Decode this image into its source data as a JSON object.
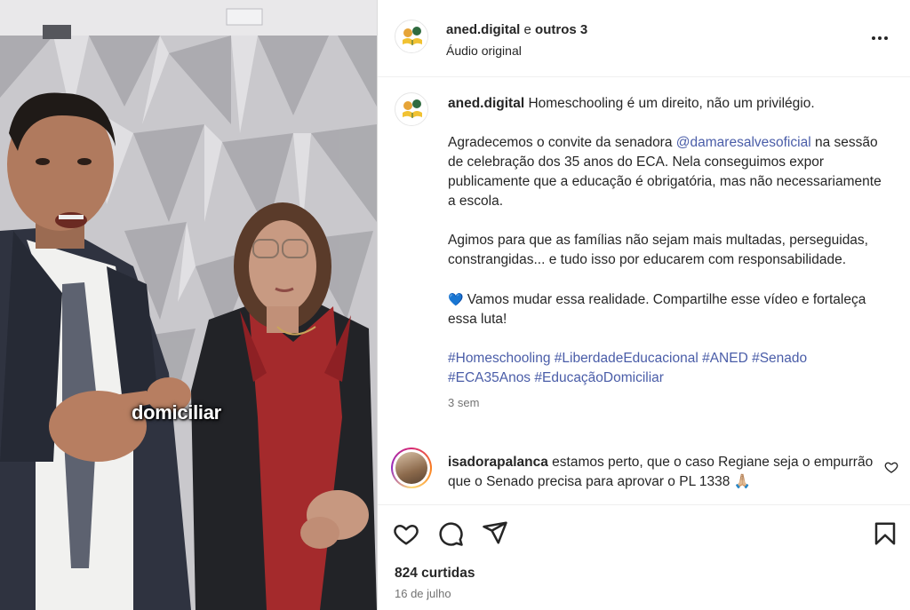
{
  "media": {
    "caption_word": "domiciliar"
  },
  "header": {
    "author": "aned.digital",
    "connector": "e",
    "others": "outros 3",
    "subtitle": "Áudio original"
  },
  "post": {
    "username": "aned.digital",
    "line1": "Homeschooling é um direito, não um privilégio.",
    "p2_before": "Agradecemos o convite da senadora ",
    "p2_mention": "@damaresalvesoficial",
    "p2_after": " na sessão de celebração dos 35 anos do ECA. Nela conseguimos expor publicamente que a educação é obrigatória, mas não necessariamente a escola.",
    "p3": "Agimos para que as famílias não sejam mais multadas, perseguidas, constrangidas... e tudo isso por educarem com responsabilidade.",
    "p4_emoji": "💙",
    "p4": " Vamos mudar essa realidade. Compartilhe esse vídeo e fortaleça essa luta!",
    "hashtags": "#Homeschooling #LiberdadeEducacional #ANED #Senado #ECA35Anos #EducaçãoDomiciliar",
    "time": "3 sem"
  },
  "comment": {
    "username": "isadorapalanca",
    "text": " estamos perto, que o caso Regiane seja o empurrão que o Senado precisa para aprovar o PL 1338",
    "emoji": "🙏🏼"
  },
  "actions": {
    "likes": "824 curtidas",
    "date": "16 de julho"
  },
  "icons": [
    "like-icon",
    "comment-icon",
    "share-icon",
    "save-icon",
    "more-options-icon",
    "heart-small-icon"
  ]
}
